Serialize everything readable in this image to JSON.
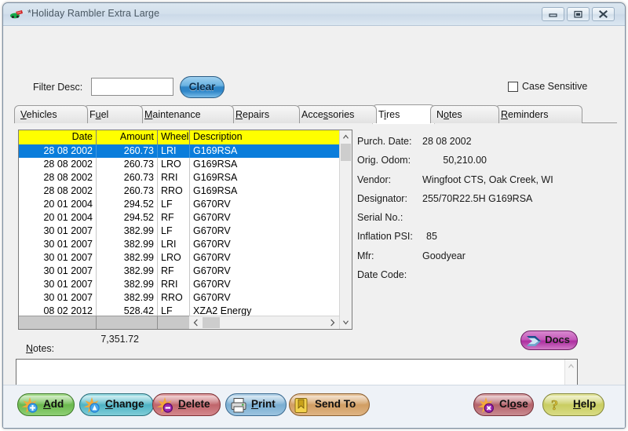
{
  "window": {
    "title": "*Holiday Rambler Extra Large",
    "icon": "rv-icon",
    "controls": {
      "minimize": "minimize-icon",
      "maximize": "maximize-icon",
      "close": "close-icon"
    }
  },
  "filter": {
    "label": "Filter Desc:",
    "value": "",
    "placeholder": "",
    "clear_label": "Clear",
    "case_sensitive_label": "Case Sensitive",
    "case_sensitive_checked": false
  },
  "tabs": [
    {
      "label": "Vehicles",
      "mnemonic": "V",
      "active": false
    },
    {
      "label": "Fuel",
      "mnemonic": "u",
      "active": false
    },
    {
      "label": "Maintenance",
      "mnemonic": "M",
      "active": false
    },
    {
      "label": "Repairs",
      "mnemonic": "R",
      "active": false
    },
    {
      "label": "Accessories",
      "mnemonic": "s",
      "active": false
    },
    {
      "label": "Tires",
      "mnemonic": "i",
      "active": true
    },
    {
      "label": "Notes",
      "mnemonic": "o",
      "active": false
    },
    {
      "label": "Reminders",
      "mnemonic": "R",
      "active": false
    }
  ],
  "grid": {
    "columns": [
      "Date",
      "Amount",
      "Wheel",
      "Description"
    ],
    "selected_row": 0,
    "rows": [
      {
        "date": "28 08 2002",
        "amount": "260.73",
        "wheel": "LRI",
        "description": "G169RSA"
      },
      {
        "date": "28 08 2002",
        "amount": "260.73",
        "wheel": "LRO",
        "description": "G169RSA"
      },
      {
        "date": "28 08 2002",
        "amount": "260.73",
        "wheel": "RRI",
        "description": "G169RSA"
      },
      {
        "date": "28 08 2002",
        "amount": "260.73",
        "wheel": "RRO",
        "description": "G169RSA"
      },
      {
        "date": "20 01 2004",
        "amount": "294.52",
        "wheel": "LF",
        "description": "G670RV"
      },
      {
        "date": "20 01 2004",
        "amount": "294.52",
        "wheel": "RF",
        "description": "G670RV"
      },
      {
        "date": "30 01 2007",
        "amount": "382.99",
        "wheel": "LF",
        "description": "G670RV"
      },
      {
        "date": "30 01 2007",
        "amount": "382.99",
        "wheel": "LRI",
        "description": "G670RV"
      },
      {
        "date": "30 01 2007",
        "amount": "382.99",
        "wheel": "LRO",
        "description": "G670RV"
      },
      {
        "date": "30 01 2007",
        "amount": "382.99",
        "wheel": "RF",
        "description": "G670RV"
      },
      {
        "date": "30 01 2007",
        "amount": "382.99",
        "wheel": "RRI",
        "description": "G670RV"
      },
      {
        "date": "30 01 2007",
        "amount": "382.99",
        "wheel": "RRO",
        "description": "G670RV"
      },
      {
        "date": "08 02 2012",
        "amount": "528.42",
        "wheel": "LF",
        "description": "XZA2 Energy"
      }
    ],
    "total": "7,351.72"
  },
  "detail": {
    "fields": [
      {
        "label": "Purch. Date:",
        "value": "28 08 2002"
      },
      {
        "label": "Orig. Odom:",
        "value": "50,210.00"
      },
      {
        "label": "Vendor:",
        "value": "Wingfoot CTS, Oak Creek, WI"
      },
      {
        "label": "Designator:",
        "value": "255/70R22.5H G169RSA"
      },
      {
        "label": "Serial No.:",
        "value": ""
      },
      {
        "label": "Inflation PSI:",
        "value": "85"
      },
      {
        "label": "Mfr:",
        "value": "Goodyear"
      },
      {
        "label": "Date Code:",
        "value": ""
      }
    ]
  },
  "notes": {
    "label": "Notes:",
    "mnemonic": "N",
    "value": "",
    "placeholder": ""
  },
  "docs_button": {
    "label": "Docs",
    "icon": "layered-arrow-icon"
  },
  "buttons": [
    {
      "id": "add",
      "label": "Add",
      "mnemonic": "A",
      "icon": "plus-badge-icon",
      "color": "#6cb94f"
    },
    {
      "id": "change",
      "label": "Change",
      "mnemonic": "C",
      "icon": "edit-badge-icon",
      "color": "#4fb3c4"
    },
    {
      "id": "delete",
      "label": "Delete",
      "mnemonic": "D",
      "icon": "delete-badge-icon",
      "color": "#c0666c"
    },
    {
      "id": "print",
      "label": "Print",
      "mnemonic": "P",
      "icon": "printer-icon",
      "color": "#7aaed2"
    },
    {
      "id": "sendto",
      "label": "Send To",
      "mnemonic": "",
      "icon": "send-arrow-icon",
      "color": "#d19e63"
    },
    {
      "id": "close",
      "label": "Close",
      "mnemonic": "o",
      "icon": "close-badge-icon",
      "color": "#b5646c"
    },
    {
      "id": "help",
      "label": "Help",
      "mnemonic": "H",
      "icon": "question-icon",
      "color": "#c9cd62"
    }
  ],
  "colors": {
    "header_yellow": "#ffff00",
    "selection_blue": "#0a7ddb",
    "titlebar": "#d3e0ec",
    "window_bg": "#f0f0f0"
  }
}
